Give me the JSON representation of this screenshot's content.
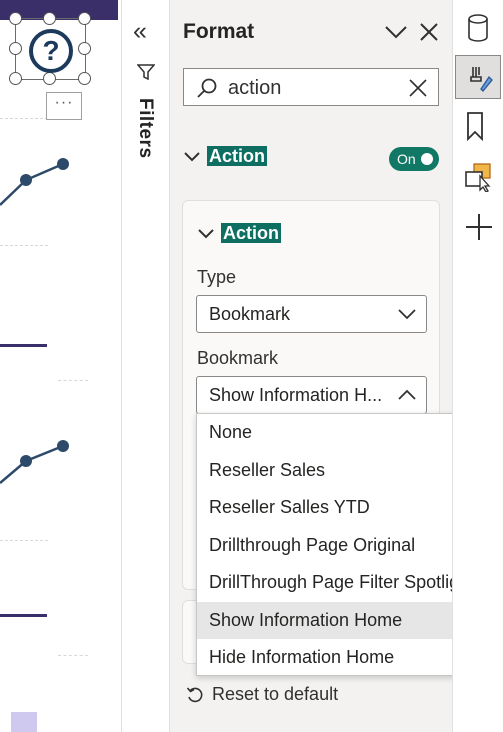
{
  "filters": {
    "label": "Filters"
  },
  "format_pane": {
    "title": "Format",
    "search": {
      "value": "action",
      "placeholder": ""
    },
    "section": {
      "title": "Action",
      "toggle_label": "On"
    },
    "card": {
      "title": "Action",
      "type_label": "Type",
      "type_value": "Bookmark",
      "bookmark_label": "Bookmark",
      "bookmark_value": "Show Information H..."
    },
    "reset_label": "Reset to default"
  },
  "bookmark_options": [
    "None",
    "Reseller Sales",
    "Reseller Salles YTD",
    "Drillthrough Page Original",
    "DrillThrough Page Filter Spotlight",
    "Show Information Home",
    "Hide Information Home"
  ],
  "selected_option": "Show Information Home",
  "canvas": {
    "help_glyph": "?",
    "more_glyph": "···"
  },
  "rail_icons": [
    "database-icon",
    "paint-brush-icon",
    "bookmark-icon",
    "selection-pointer-icon",
    "plus-icon"
  ],
  "colors": {
    "accent": "#117865",
    "highlight": "#0e6e61",
    "canvas_purple": "#3b2f6a",
    "line_blue": "#2e4a6b"
  }
}
